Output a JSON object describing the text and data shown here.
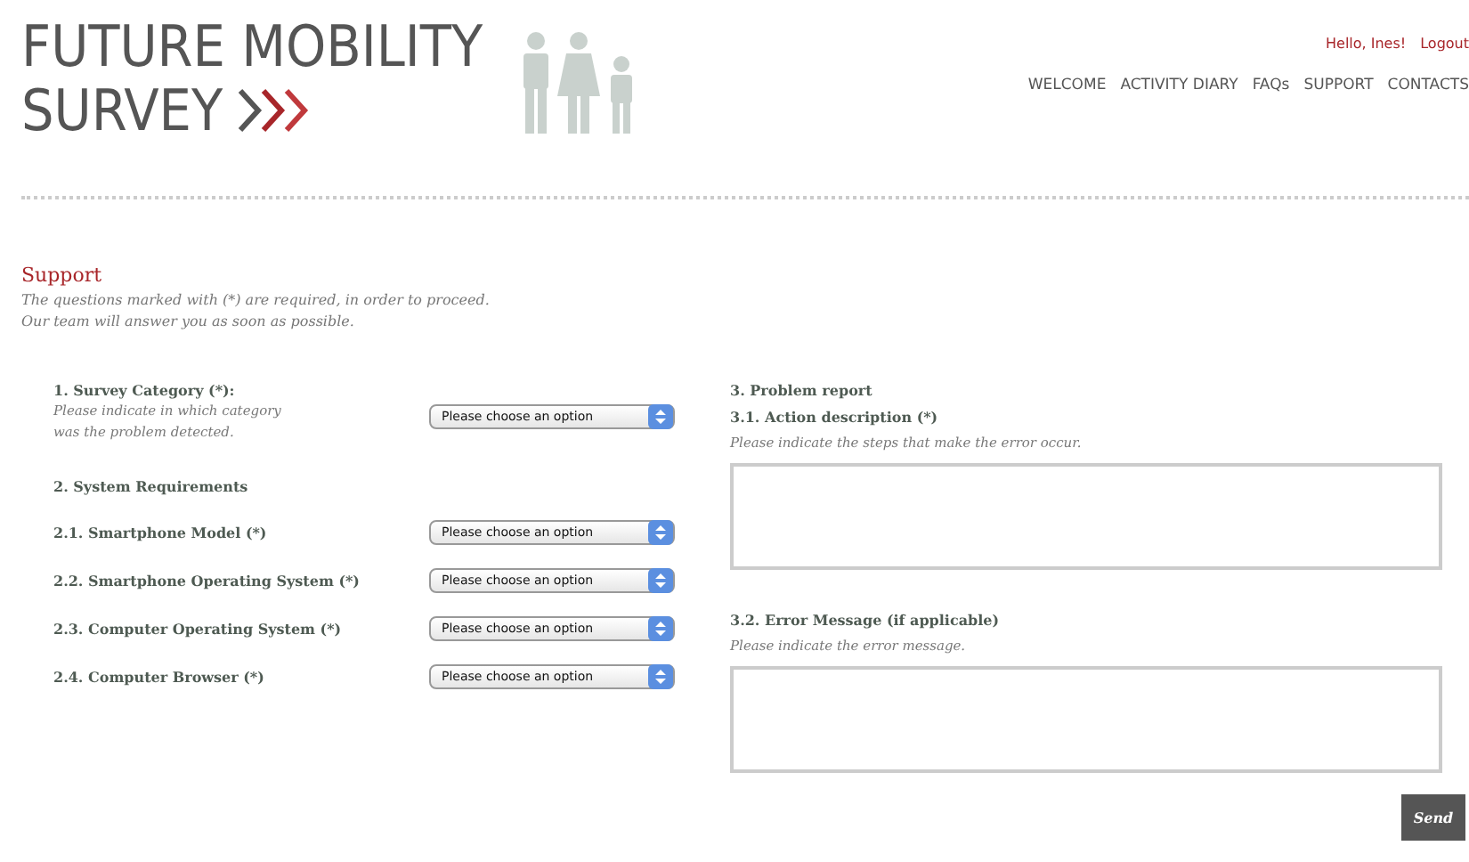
{
  "logo": {
    "line1": "FUTURE MOBILITY",
    "line2": "SURVEY"
  },
  "user_links": [
    "Hello, Ines!",
    "Logout"
  ],
  "nav": [
    {
      "label": "WELCOME",
      "selected": false
    },
    {
      "label": "ACTIVITY DIARY",
      "selected": false
    },
    {
      "label": "FAQs",
      "selected": false
    },
    {
      "label": "SUPPORT",
      "selected": false
    },
    {
      "label": "CONTACTS",
      "selected": false
    }
  ],
  "page": {
    "title": "Support",
    "intro": [
      "The questions marked with (*) are required, in order to proceed.",
      "Our team will answer you as soon as possible."
    ]
  },
  "category": {
    "label": "1. Survey Category (*):",
    "hint": [
      "Please indicate in which category",
      "was the problem detected."
    ],
    "value": "Please choose an option"
  },
  "system": {
    "heading": "2. System Requirements",
    "fields": [
      {
        "label": "2.1. Smartphone Model (*)",
        "value": "Please choose an option"
      },
      {
        "label": "2.2. Smartphone Operating System (*)",
        "value": "Please choose an option"
      },
      {
        "label": "2.3. Computer Operating System (*)",
        "value": "Please choose an option"
      },
      {
        "label": "2.4. Computer Browser (*)",
        "value": "Please choose an option"
      }
    ]
  },
  "problem": {
    "heading": "3. Problem report",
    "fields": [
      {
        "label": "3.1. Action description (*)",
        "hint": "Please indicate the steps that make the error occur."
      },
      {
        "label": "3.2. Error Message (if applicable)",
        "hint": "Please indicate the error message."
      }
    ]
  },
  "send_button": "Send"
}
